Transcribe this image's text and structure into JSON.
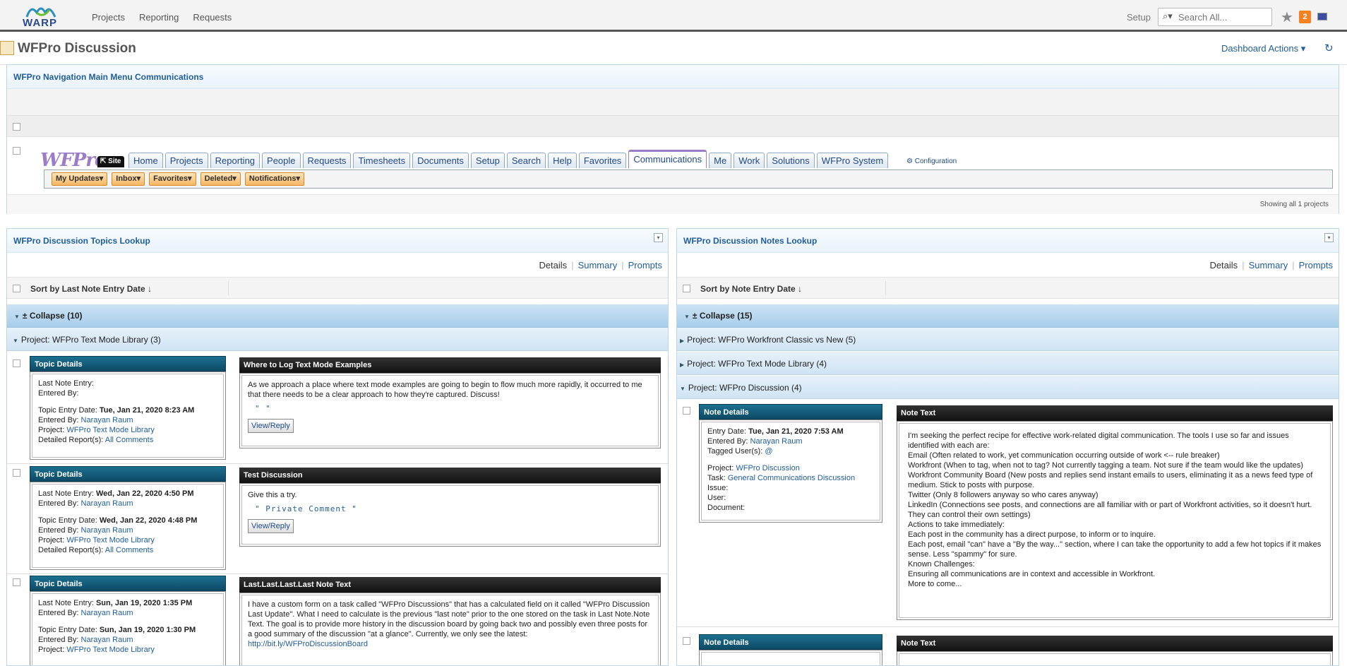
{
  "topbar": {
    "logo_text": "WARP",
    "nav": [
      "Projects",
      "Reporting",
      "Requests"
    ],
    "setup": "Setup",
    "search_placeholder": "Search All...",
    "notification_count": "2"
  },
  "title": {
    "page_title": "WFPro Discussion",
    "dashboard_actions": "Dashboard Actions ▾",
    "refresh_icon": "↻"
  },
  "nav_panel": {
    "title": "WFPro Navigation Main Menu Communications",
    "wfpro_logo": "WFPro",
    "site_badge": "⇱ Site",
    "tabs": [
      "Home",
      "Projects",
      "Reporting",
      "People",
      "Requests",
      "Timesheets",
      "Documents",
      "Setup",
      "Search",
      "Help",
      "Favorites",
      "Communications",
      "Me",
      "Work",
      "Solutions",
      "WFPro System"
    ],
    "active_tab": "Communications",
    "config_link": "Configuration",
    "subtabs": [
      "My Updates▾",
      "Inbox▾",
      "Favorites▾",
      "Deleted▾",
      "Notifications▾"
    ],
    "footer": "Showing all 1 projects"
  },
  "topics": {
    "title": "WFPro Discussion Topics Lookup",
    "view_links": {
      "details": "Details",
      "summary": "Summary",
      "prompts": "Prompts"
    },
    "sort_label": "Sort by Last Note Entry Date ↓",
    "collapse": "± Collapse (10)",
    "project_group": "Project: WFPro Text Mode Library (3)",
    "card_header": "Topic Details",
    "labels": {
      "last_note": "Last Note Entry:",
      "entered_by": "Entered By:",
      "topic_date": "Topic Entry Date:",
      "project": "Project:",
      "detailed": "Detailed Report(s):"
    },
    "view_reply": "View/Reply",
    "records": [
      {
        "last_note": "",
        "last_by": "",
        "topic_date": "Tue, Jan 21, 2020 8:23 AM",
        "topic_by": "Narayan Raum",
        "project": "WFPro Text Mode Library",
        "detailed": "All Comments",
        "text_title": "Where to Log Text Mode Examples",
        "text": "As we approach a place where text mode examples are going to begin to flow much more rapidly, it occurred to me that there needs to be a clear approach to how they're captured. Discuss!",
        "private": "\" \""
      },
      {
        "last_note": "Wed, Jan 22, 2020 4:50 PM",
        "last_by": "Narayan Raum",
        "topic_date": "Wed, Jan 22, 2020 4:48 PM",
        "topic_by": "Narayan Raum",
        "project": "WFPro Text Mode Library",
        "detailed": "All Comments",
        "text_title": "Test Discussion",
        "text": "Give this a try.",
        "private": "\" Private Comment \""
      },
      {
        "last_note": "Sun, Jan 19, 2020 1:35 PM",
        "last_by": "Narayan Raum",
        "topic_date": "Sun, Jan 19, 2020 1:30 PM",
        "topic_by": "Narayan Raum",
        "project": "WFPro Text Mode Library",
        "text_title": "Last.Last.Last.Last Note Text",
        "text": "I have a custom form on a task called \"WFPro Discussions\" that has a calculated field on it called \"WFPro Discussion Last Update\". What I need to calculate is the previous \"last note\" prior to the one stored on the task in Last Note.Note Text. The goal is to provide more history in the discussion board by going back two and possibly even three posts for a good summary of the discussion \"at a glance\". Currently, we only see the latest:",
        "link": "http://bit.ly/WFProDiscussionBoard"
      }
    ]
  },
  "notes": {
    "title": "WFPro Discussion Notes Lookup",
    "view_links": {
      "details": "Details",
      "summary": "Summary",
      "prompts": "Prompts"
    },
    "sort_label": "Sort by Note Entry Date ↓",
    "collapse": "± Collapse (15)",
    "groups": [
      "Project: WFPro Workfront Classic vs New (5)",
      "Project: WFPro Text Mode Library (4)",
      "Project: WFPro Discussion (4)"
    ],
    "card_header": "Note Details",
    "text_header": "Note Text",
    "labels": {
      "entry_date": "Entry Date:",
      "entered_by": "Entered By:",
      "tagged": "Tagged User(s):",
      "project": "Project:",
      "task": "Task:",
      "issue": "Issue:",
      "user": "User:",
      "document": "Document:"
    },
    "record": {
      "entry_date": "Tue, Jan 21, 2020 7:53 AM",
      "entered_by": "Narayan Raum",
      "tagged": "@",
      "project": "WFPro Discussion",
      "task": "General Communications Discussion",
      "text_lines": [
        "I'm seeking the perfect recipe for effective work-related digital communication. The tools I use so far and issues identified with each are:",
        "Email (Often related to work, yet communication occurring outside of work <-- rule breaker)",
        "Workfront (When to tag, when not to tag? Not currently tagging a team. Not sure if the team would like the updates)",
        "Workfront Community Board (New posts and replies send instant emails to users, eliminating it as a news feed type of medium. Stick to posts with purpose.",
        "Twitter (Only 8 followers anyway so who cares anyway)",
        "LinkedIn (Connections see posts, and connections are all familiar with or part of Workfront activities, so it doesn't hurt. They can control their own settings)",
        "",
        "Actions to take immediately:",
        "Each post in the community has a direct purpose, to inform or to inquire.",
        "Each post, email \"can\" have a \"By the way...\" section, where I can take the opportunity to add a few hot topics if it makes sense. Less \"spammy\" for sure.",
        "",
        "Known Challenges:",
        "Ensuring all communications are in context and accessible in Workfront.",
        "More to come..."
      ]
    }
  }
}
